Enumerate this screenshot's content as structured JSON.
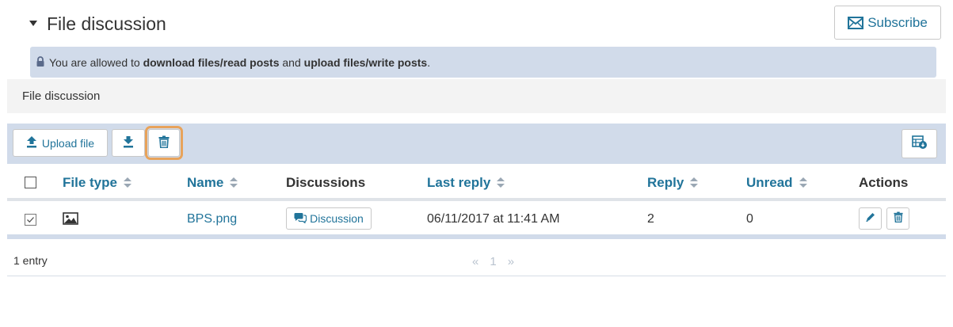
{
  "header": {
    "title": "File discussion",
    "subscribe_label": "Subscribe"
  },
  "permissions": {
    "prefix": "You are allowed to ",
    "read": "download files/read posts",
    "middle": " and ",
    "write": "upload files/write posts",
    "suffix": "."
  },
  "section": {
    "label": "File discussion"
  },
  "toolbar": {
    "upload_label": "Upload file"
  },
  "table": {
    "headers": {
      "file_type": "File type",
      "name": "Name",
      "discussions": "Discussions",
      "last_reply": "Last reply",
      "reply": "Reply",
      "unread": "Unread",
      "actions": "Actions"
    },
    "rows": [
      {
        "checked": true,
        "file_type_icon": "image-icon",
        "name": "BPS.png",
        "discussion_label": "Discussion",
        "last_reply": "06/11/2017 at 11:41 AM",
        "reply": "2",
        "unread": "0"
      }
    ]
  },
  "footer": {
    "entry_count": "1 entry",
    "prev": "«",
    "page": "1",
    "next": "»"
  },
  "colors": {
    "link": "#21749a",
    "banner": "#d1dbea",
    "highlight": "#e8a35b"
  }
}
